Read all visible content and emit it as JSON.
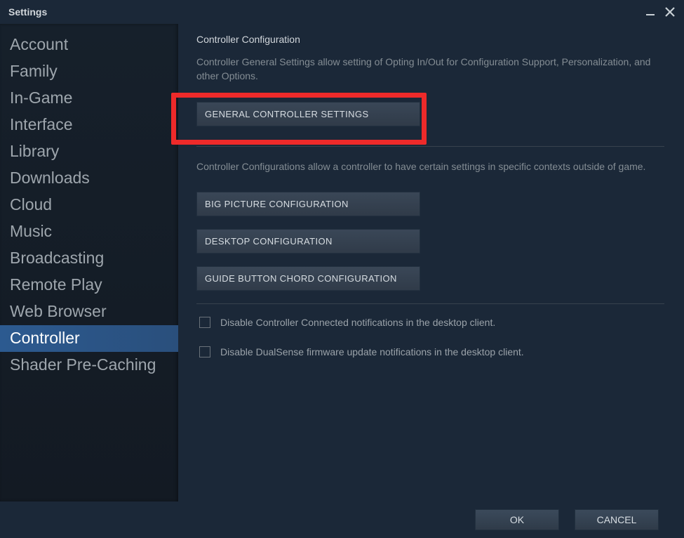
{
  "window": {
    "title": "Settings"
  },
  "sidebar": {
    "items": [
      {
        "label": "Account",
        "selected": false
      },
      {
        "label": "Family",
        "selected": false
      },
      {
        "label": "In-Game",
        "selected": false
      },
      {
        "label": "Interface",
        "selected": false
      },
      {
        "label": "Library",
        "selected": false
      },
      {
        "label": "Downloads",
        "selected": false
      },
      {
        "label": "Cloud",
        "selected": false
      },
      {
        "label": "Music",
        "selected": false
      },
      {
        "label": "Broadcasting",
        "selected": false
      },
      {
        "label": "Remote Play",
        "selected": false
      },
      {
        "label": "Web Browser",
        "selected": false
      },
      {
        "label": "Controller",
        "selected": true
      },
      {
        "label": "Shader Pre-Caching",
        "selected": false
      }
    ]
  },
  "content": {
    "section_title": "Controller Configuration",
    "general_desc": "Controller General Settings allow setting of Opting In/Out for Configuration Support, Personalization, and other Options.",
    "general_button": "GENERAL CONTROLLER SETTINGS",
    "config_desc": "Controller Configurations allow a controller to have certain settings in specific contexts outside of game.",
    "buttons": {
      "big_picture": "BIG PICTURE CONFIGURATION",
      "desktop": "DESKTOP CONFIGURATION",
      "guide_chord": "GUIDE BUTTON CHORD CONFIGURATION"
    },
    "checkboxes": {
      "disable_connected": "Disable Controller Connected notifications in the desktop client.",
      "disable_dualsense": "Disable DualSense firmware update notifications in the desktop client."
    }
  },
  "footer": {
    "ok": "OK",
    "cancel": "CANCEL"
  },
  "annotation": {
    "highlight_color": "#ee2a2a"
  }
}
